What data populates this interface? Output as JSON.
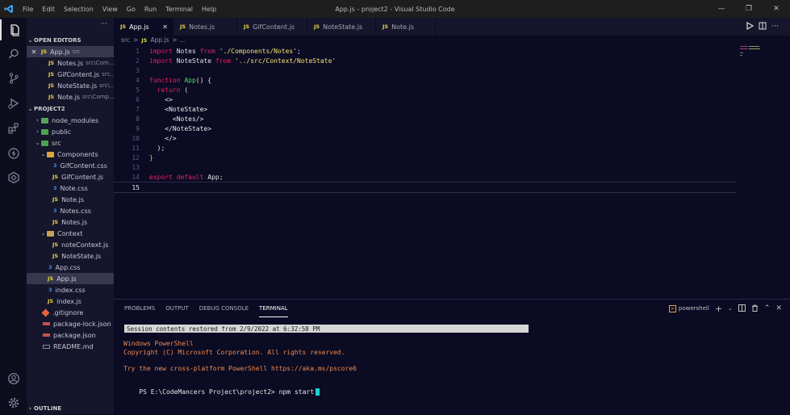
{
  "titlebar": {
    "menu": [
      "File",
      "Edit",
      "Selection",
      "View",
      "Go",
      "Run",
      "Terminal",
      "Help"
    ],
    "title": "App.js - project2 - Visual Studio Code"
  },
  "activity_bar": {
    "items": [
      "explorer-icon",
      "search-icon",
      "source-control-icon",
      "run-debug-icon",
      "extensions-icon",
      "lightning-icon",
      "remote-icon",
      "account-icon",
      "gear-icon"
    ]
  },
  "sidebar": {
    "more_label": "···",
    "open_editors_label": "OPEN EDITORS",
    "open_editors": [
      {
        "ext": "JS",
        "name": "App.js",
        "desc": "src",
        "close": "✕"
      },
      {
        "ext": "JS",
        "name": "Notes.js",
        "desc": "src\\Com..."
      },
      {
        "ext": "JS",
        "name": "GifContent.js",
        "desc": "src..."
      },
      {
        "ext": "JS",
        "name": "NoteState.js",
        "desc": "src\\..."
      },
      {
        "ext": "JS",
        "name": "Note.js",
        "desc": "src\\Comp..."
      }
    ],
    "project_label": "PROJECT2",
    "tree": {
      "node_modules": "node_modules",
      "public": "public",
      "src": "src",
      "components": "Components",
      "components_files": [
        {
          "ext": "css",
          "name": "GifContent.css"
        },
        {
          "ext": "js",
          "name": "GifContent.js"
        },
        {
          "ext": "css",
          "name": "Note.css"
        },
        {
          "ext": "js",
          "name": "Note.js"
        },
        {
          "ext": "css",
          "name": "Notes.css"
        },
        {
          "ext": "js",
          "name": "Notes.js"
        }
      ],
      "context": "Context",
      "context_files": [
        {
          "ext": "js",
          "name": "noteContext.js"
        },
        {
          "ext": "js",
          "name": "NoteState.js"
        }
      ],
      "src_files": [
        {
          "ext": "css",
          "name": "App.css"
        },
        {
          "ext": "js",
          "name": "App.js"
        },
        {
          "ext": "css",
          "name": "index.css"
        },
        {
          "ext": "js",
          "name": "index.js"
        }
      ],
      "root_files": [
        ".gitignore",
        "package-lock.json",
        "package.json",
        "README.md"
      ]
    },
    "outline_label": "OUTLINE"
  },
  "tabs": [
    {
      "ext": "JS",
      "name": "App.js",
      "close": "✕"
    },
    {
      "ext": "JS",
      "name": "Notes.js"
    },
    {
      "ext": "JS",
      "name": "GifContent.js"
    },
    {
      "ext": "JS",
      "name": "NoteState.js"
    },
    {
      "ext": "JS",
      "name": "Note.js"
    }
  ],
  "breadcrumb": {
    "folder": "src",
    "sep": ">",
    "ext": "JS",
    "file": "App.js",
    "rest": "> ..."
  },
  "editor": {
    "lines": [
      {
        "n": "1",
        "kw": "import",
        "a": " Notes ",
        "kw2": "from",
        "str": " './Components/Notes'",
        "end": ";"
      },
      {
        "n": "2",
        "kw": "import",
        "a": " NoteState ",
        "kw2": "from",
        "str": " '../src/Context/NoteState'",
        "end": ""
      },
      {
        "n": "3"
      },
      {
        "n": "4",
        "kw": "function",
        "fn": " App",
        "end": "() {"
      },
      {
        "n": "5",
        "kw": "  return",
        "end": " ("
      },
      {
        "n": "6",
        "text": "    <>"
      },
      {
        "n": "7",
        "text": "    <NoteState>"
      },
      {
        "n": "8",
        "text": "      <Notes/>"
      },
      {
        "n": "9",
        "text": "    </NoteState>"
      },
      {
        "n": "10",
        "text": "    </>"
      },
      {
        "n": "11",
        "text": "  );"
      },
      {
        "n": "12",
        "text": "}"
      },
      {
        "n": "13"
      },
      {
        "n": "14",
        "kw": "export default",
        "a": " App;"
      },
      {
        "n": "15"
      }
    ]
  },
  "panel": {
    "tabs": [
      "PROBLEMS",
      "OUTPUT",
      "DEBUG CONSOLE",
      "TERMINAL"
    ],
    "shell": "powershell",
    "restored": "Session contents restored from 2/9/2022 at 6:32:58 PM",
    "ps_title": "Windows PowerShell",
    "copyright": "Copyright (C) Microsoft Corporation. All rights reserved.",
    "try_new": "Try the new cross-platform PowerShell https://aka.ms/pscore6",
    "prompt": "PS E:\\CodeMancers Project\\project2>",
    "command": "npm start"
  }
}
